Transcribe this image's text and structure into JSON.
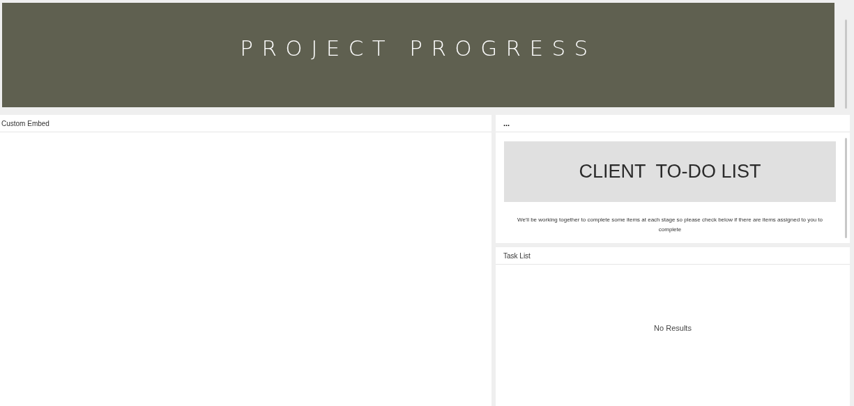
{
  "banner": {
    "title": "PROJECT PROGRESS"
  },
  "embed_panel": {
    "title": "Custom Embed"
  },
  "todo_panel": {
    "title": "...",
    "heading": "CLIENT  TO-DO LIST",
    "description": "We'll be working together to complete some items at each stage so please check below if there are items assigned to you to complete"
  },
  "task_list": {
    "title": "Task List",
    "empty_message": "No Results"
  }
}
